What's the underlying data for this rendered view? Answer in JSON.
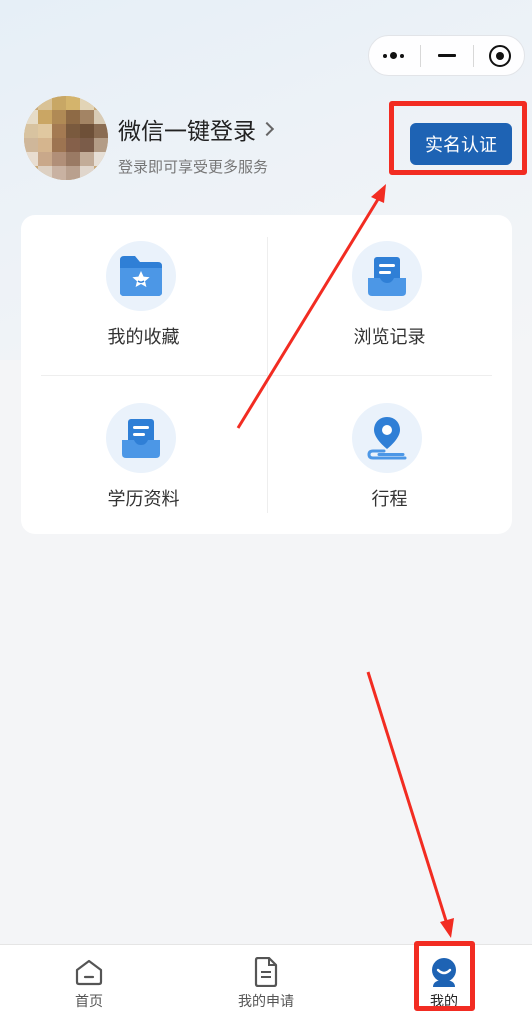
{
  "header": {
    "capsule": {
      "more_icon": "more-dots-icon",
      "minimize_icon": "minus-icon",
      "close_icon": "target-icon"
    }
  },
  "user": {
    "name": "微信一键登录",
    "subtitle": "登录即可享受更多服务",
    "avatar_icon": "blurred-avatar",
    "verify_label": "实名认证"
  },
  "grid": {
    "items": [
      {
        "label": "我的收藏",
        "icon": "folder-star-icon"
      },
      {
        "label": "浏览记录",
        "icon": "document-tray-icon"
      },
      {
        "label": "学历资料",
        "icon": "document-tray-icon"
      },
      {
        "label": "行程",
        "icon": "location-pin-icon"
      }
    ]
  },
  "tabbar": {
    "items": [
      {
        "label": "首页",
        "icon": "home-icon"
      },
      {
        "label": "我的申请",
        "icon": "document-icon"
      },
      {
        "label": "我的",
        "icon": "person-icon",
        "active": true
      }
    ]
  },
  "colors": {
    "accent": "#1e63b4",
    "icon_blue": "#2f7fd6",
    "annotation_red": "#f22c22"
  }
}
